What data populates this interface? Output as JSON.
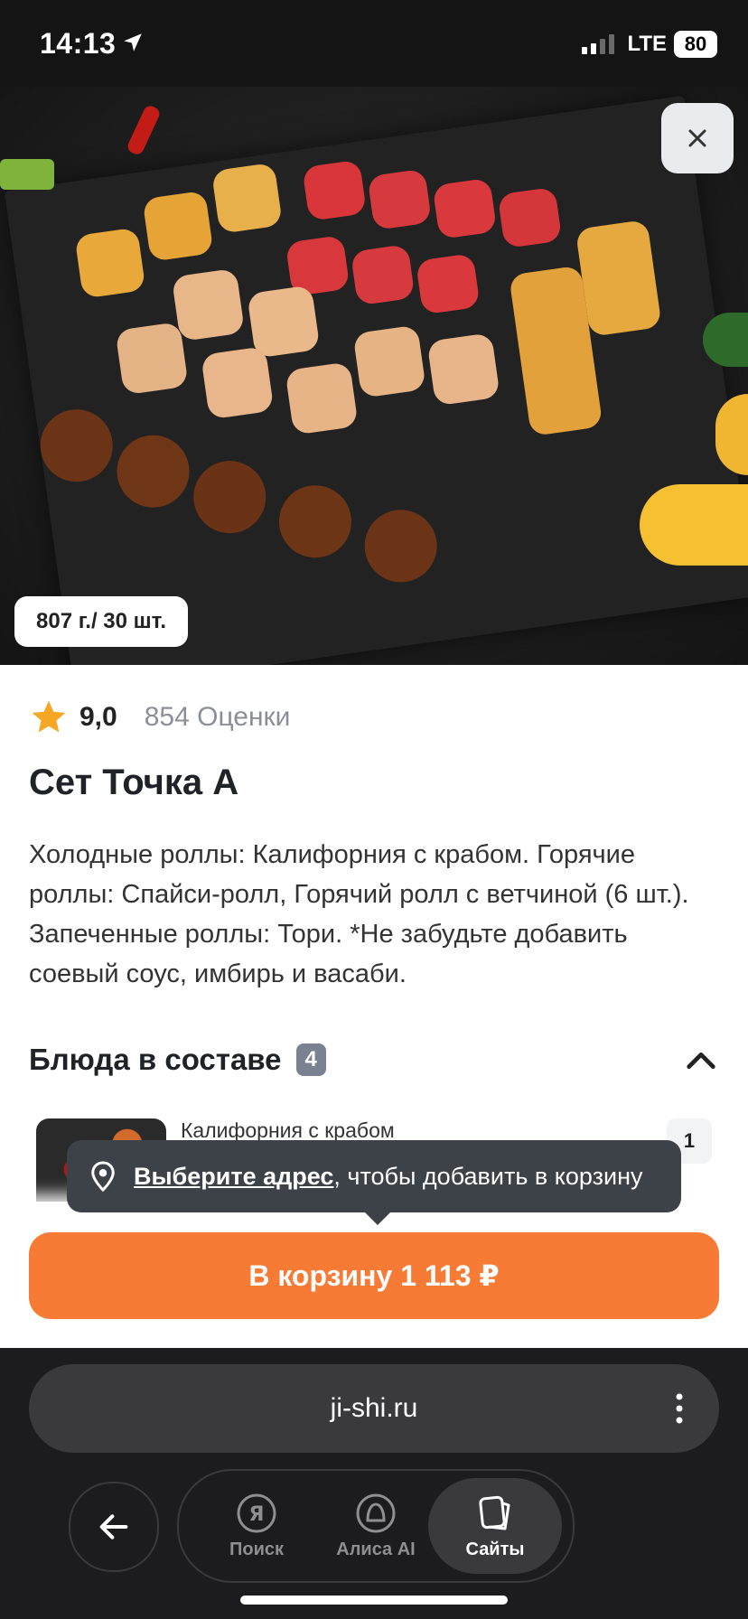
{
  "status_bar": {
    "time": "14:13",
    "network": "LTE",
    "battery": "80"
  },
  "hero": {
    "weight_badge": "807 г./ 30 шт."
  },
  "product": {
    "rating": "9,0",
    "rating_count": "854 Оценки",
    "title": "Сет Точка А",
    "description": "Холодные роллы: Калифорния с крабом. Горячие роллы: Спайси-ролл, Горячий ролл с ветчиной (6 шт.). Запеченные роллы: Тори. *Не забудьте добавить соевый соус, имбирь и васаби."
  },
  "composition": {
    "title": "Блюда в составе",
    "count": "4",
    "first_dish": {
      "name": "Калифорния с крабом",
      "qty": "1"
    }
  },
  "tooltip": {
    "link": "Выберите адрес",
    "text": ", чтобы добавить в корзину"
  },
  "cart_button": {
    "label": "В корзину 1 113 ₽"
  },
  "browser": {
    "url": "ji-shi.ru",
    "tabs": [
      {
        "label": "Поиск",
        "icon": "yandex-icon"
      },
      {
        "label": "Алиса AI",
        "icon": "alice-icon"
      },
      {
        "label": "Сайты",
        "icon": "sites-icon"
      }
    ]
  },
  "colors": {
    "accent": "#f77b34",
    "star": "#f5a623",
    "tooltip_bg": "#3d4148"
  }
}
